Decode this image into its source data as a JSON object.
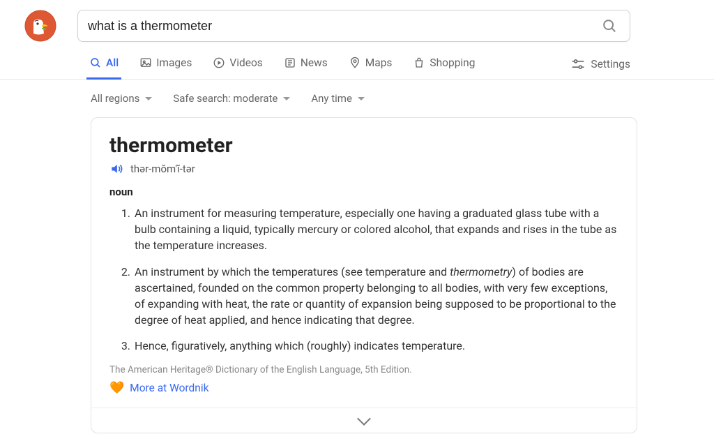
{
  "search": {
    "query": "what is a thermometer"
  },
  "tabs": {
    "all": "All",
    "images": "Images",
    "videos": "Videos",
    "news": "News",
    "maps": "Maps",
    "shopping": "Shopping",
    "settings": "Settings"
  },
  "filters": {
    "region": "All regions",
    "safesearch": "Safe search: moderate",
    "time": "Any time"
  },
  "definition": {
    "word": "thermometer",
    "pronunciation": "thər-mŏm′ĭ-tər",
    "part_of_speech": "noun",
    "senses": [
      "An instrument for measuring temperature, especially one having a graduated glass tube with a bulb containing a liquid, typically mercury or colored alcohol, that expands and rises in the tube as the temperature increases.",
      "An instrument by which the temperatures (see temperature and <em>thermometry</em>) of bodies are ascertained, founded on the common property belonging to all bodies, with very few exceptions, of expanding with heat, the rate or quantity of expansion being supposed to be proportional to the degree of heat applied, and hence indicating that degree.",
      "Hence, figuratively, anything which (roughly) indicates temperature."
    ],
    "source": "The American Heritage® Dictionary of the English Language, 5th Edition.",
    "more_link": "More at Wordnik"
  }
}
